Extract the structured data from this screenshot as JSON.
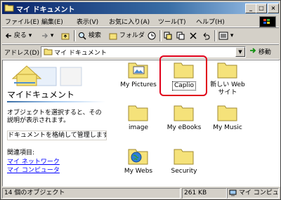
{
  "window": {
    "title": "マイ ドキュメント"
  },
  "menu": [
    "ファイル(E)",
    "編集(E)",
    "表示(V)",
    "お気に入り(A)",
    "ツール(T)",
    "ヘルプ(H)"
  ],
  "toolbar": {
    "back": "戻る",
    "search": "検索",
    "folders": "フォルダ"
  },
  "address": {
    "label": "アドレス(D)",
    "value": "マイ ドキュメント",
    "go": "移動"
  },
  "left_pane": {
    "title": "マイドキュメント",
    "desc": "オブジェクトを選択すると、その説明が表示されます。",
    "status": "ドキュメントを格納して管理します",
    "related": "関連項目:",
    "links": [
      "マイ ネットワーク",
      "マイ コンピュータ"
    ]
  },
  "folders": [
    {
      "label": "My Pictures",
      "icon": "pictures-folder-icon"
    },
    {
      "label": "Caplio",
      "icon": "folder-icon",
      "selected": true
    },
    {
      "label": "新しい Web サイト",
      "icon": "folder-icon"
    },
    {
      "label": "image",
      "icon": "folder-icon"
    },
    {
      "label": "My eBooks",
      "icon": "folder-icon"
    },
    {
      "label": "My Music",
      "icon": "folder-icon"
    },
    {
      "label": "My Webs",
      "icon": "webs-folder-icon"
    },
    {
      "label": "Security",
      "icon": "folder-icon"
    }
  ],
  "status": {
    "count": "14 個のオブジェクト",
    "size": "261 KB",
    "location": "マイ コンピュータ"
  },
  "colors": {
    "title_bar": "#0a246a",
    "highlight": "#e0001a",
    "link": "#0000ff",
    "folder": "#f5e27a"
  }
}
